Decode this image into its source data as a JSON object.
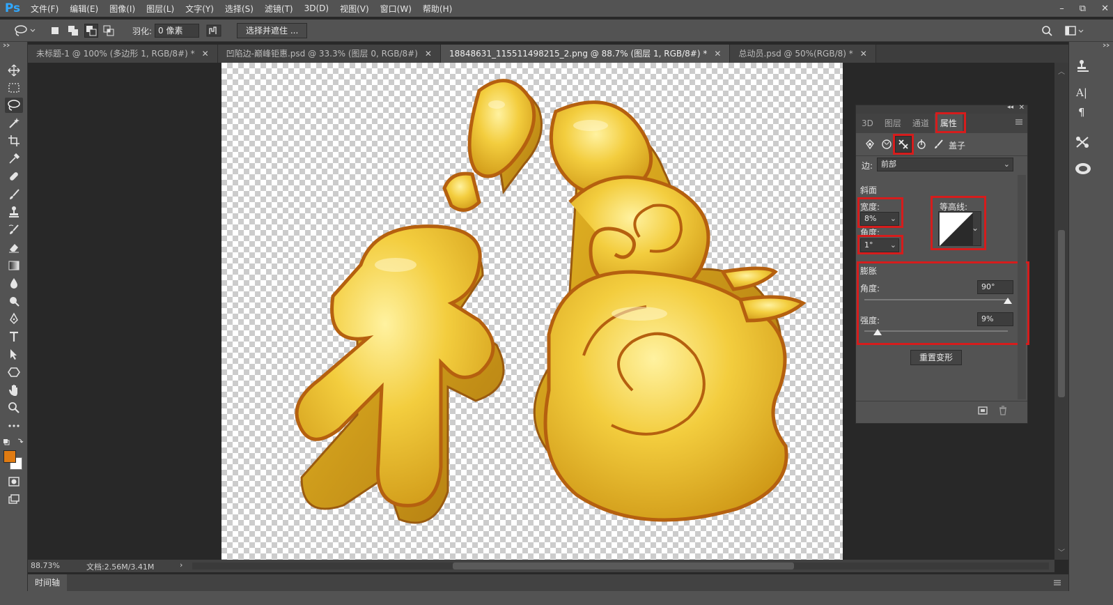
{
  "app": {
    "logo": "Ps"
  },
  "menu": [
    "文件(F)",
    "编辑(E)",
    "图像(I)",
    "图层(L)",
    "文字(Y)",
    "选择(S)",
    "滤镜(T)",
    "3D(D)",
    "视图(V)",
    "窗口(W)",
    "帮助(H)"
  ],
  "window_controls": {
    "minimize": "–",
    "restore": "⧉",
    "close": "✕"
  },
  "options": {
    "feather_label": "羽化:",
    "feather_value": "0 像素",
    "select_mask_button": "选择并遮住 ..."
  },
  "tabs": [
    {
      "label": "未标题-1 @ 100% (多边形 1, RGB/8#) *",
      "close": "✕"
    },
    {
      "label": "凹陷边-巅峰钜惠.psd @ 33.3% (图层 0, RGB/8#)",
      "close": "✕"
    },
    {
      "label": "18848631_115511498215_2.png @ 88.7% (图层 1, RGB/8#) *",
      "close": "✕"
    },
    {
      "label": "总动员.psd @ 50%(RGB/8) *",
      "close": "✕"
    }
  ],
  "properties": {
    "panel_tabs": [
      "3D",
      "图层",
      "通道",
      "属性"
    ],
    "active_tab": "属性",
    "mode_label": "盖子",
    "side_label": "边:",
    "side_value": "前部",
    "bevel_section": "斜面",
    "width_label": "宽度:",
    "width_value": "8%",
    "angle_label": "角度:",
    "angle_value": "1°",
    "contour_label": "等高线:",
    "inflate_section": "膨胀",
    "inflate_angle_label": "角度:",
    "inflate_angle_value": "90°",
    "strength_label": "强度:",
    "strength_value": "9%",
    "reset_button": "重置变形"
  },
  "sliders": {
    "inflate_angle_fraction": 1.0,
    "strength_fraction": 0.09
  },
  "status": {
    "zoom": "88.73%",
    "doc": "文档:2.56M/3.41M",
    "arrow": "›"
  },
  "timeline": {
    "label": "时间轴"
  },
  "colors": {
    "accent_red": "#d61c1c",
    "foreground": "#e07b12",
    "background": "#ffffff",
    "gold": "#f0c93a"
  }
}
